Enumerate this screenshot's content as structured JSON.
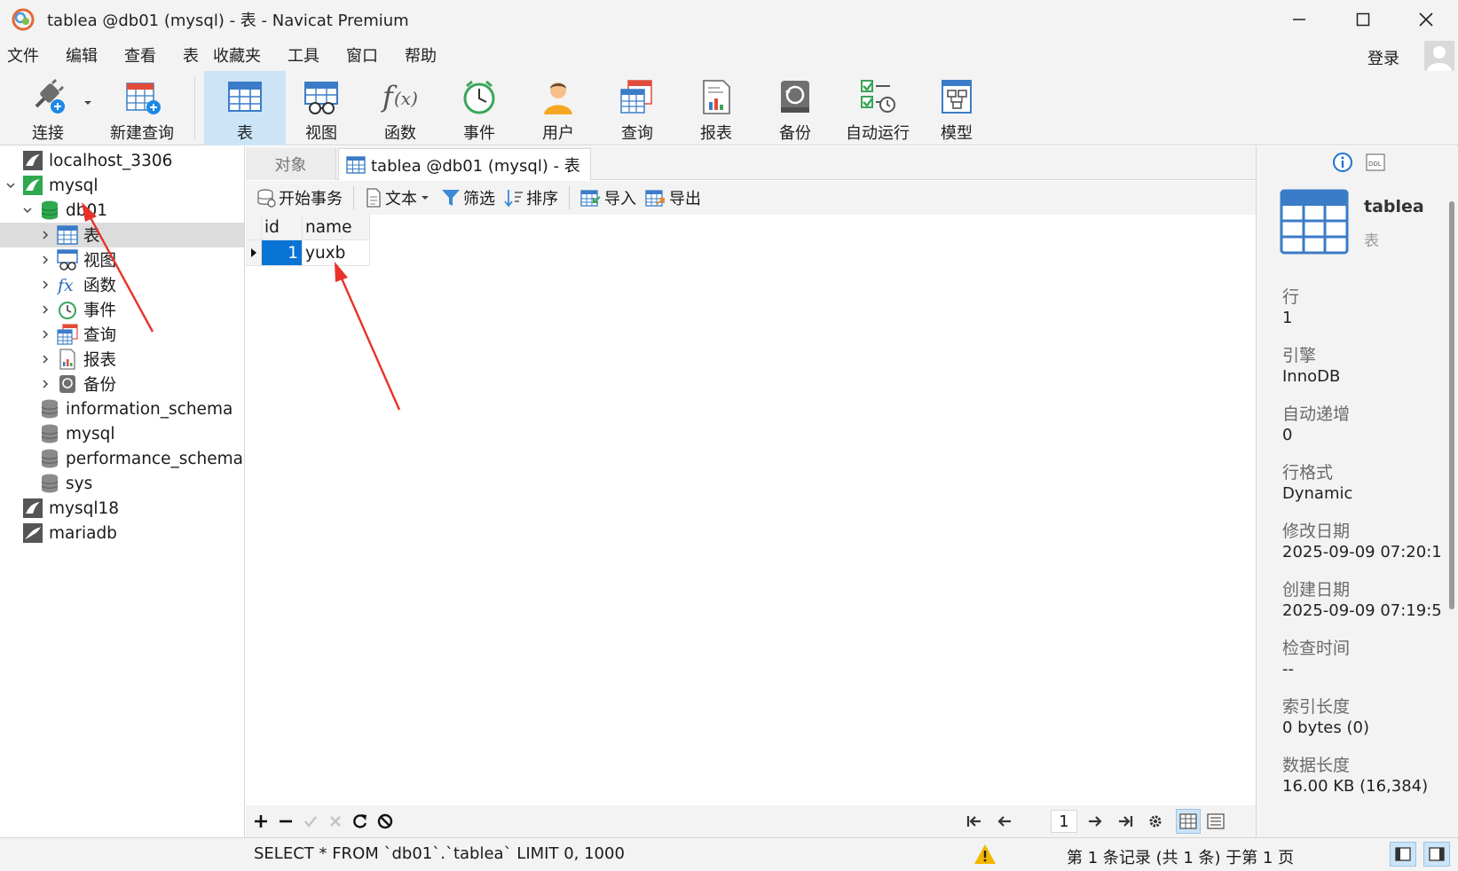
{
  "window": {
    "title": "tablea @db01 (mysql) - 表 - Navicat Premium"
  },
  "menu": [
    "文件",
    "编辑",
    "查看",
    "表",
    "收藏夹",
    "工具",
    "窗口",
    "帮助"
  ],
  "account": {
    "login_label": "登录"
  },
  "toolbar": {
    "connect": "连接",
    "new_query": "新建查询",
    "table": "表",
    "view": "视图",
    "function": "函数",
    "event": "事件",
    "user": "用户",
    "query": "查询",
    "report": "报表",
    "backup": "备份",
    "auto_run": "自动运行",
    "model": "模型"
  },
  "tree": {
    "connections": [
      {
        "label": "localhost_3306"
      },
      {
        "label": "mysql"
      },
      {
        "label": "db01"
      },
      {
        "label": "表"
      },
      {
        "label": "视图"
      },
      {
        "label": "函数"
      },
      {
        "label": "事件"
      },
      {
        "label": "查询"
      },
      {
        "label": "报表"
      },
      {
        "label": "备份"
      },
      {
        "label": "information_schema"
      },
      {
        "label": "mysql"
      },
      {
        "label": "performance_schema"
      },
      {
        "label": "sys"
      },
      {
        "label": "mysql18"
      },
      {
        "label": "mariadb"
      }
    ]
  },
  "tabs": {
    "objects": "对象",
    "active": "tablea @db01 (mysql) - 表"
  },
  "subtoolbar": {
    "begin_transaction": "开始事务",
    "text": "文本",
    "filter": "筛选",
    "sort": "排序",
    "import": "导入",
    "export": "导出"
  },
  "grid": {
    "columns": [
      "id",
      "name"
    ],
    "rows": [
      {
        "id": "1",
        "name": "yuxb"
      }
    ]
  },
  "pagination": {
    "page": "1"
  },
  "status": {
    "sql": "SELECT * FROM `db01`.`tablea` LIMIT 0, 1000",
    "record": "第 1 条记录 (共 1 条) 于第 1 页"
  },
  "info": {
    "name": "tablea",
    "type": "表",
    "rows_label": "行",
    "rows_value": "1",
    "engine_label": "引擎",
    "engine_value": "InnoDB",
    "auto_inc_label": "自动递增",
    "auto_inc_value": "0",
    "row_format_label": "行格式",
    "row_format_value": "Dynamic",
    "modified_label": "修改日期",
    "modified_value": "2025-09-09 07:20:1",
    "created_label": "创建日期",
    "created_value": "2025-09-09 07:19:5",
    "checked_label": "检查时间",
    "checked_value": "--",
    "index_len_label": "索引长度",
    "index_len_value": "0 bytes (0)",
    "data_len_label": "数据长度",
    "data_len_value": "16.00 KB (16,384)"
  },
  "colors": {
    "accent": "#0078d7",
    "selected_tab": "#cce4f7",
    "annotation": "#e8322a"
  }
}
